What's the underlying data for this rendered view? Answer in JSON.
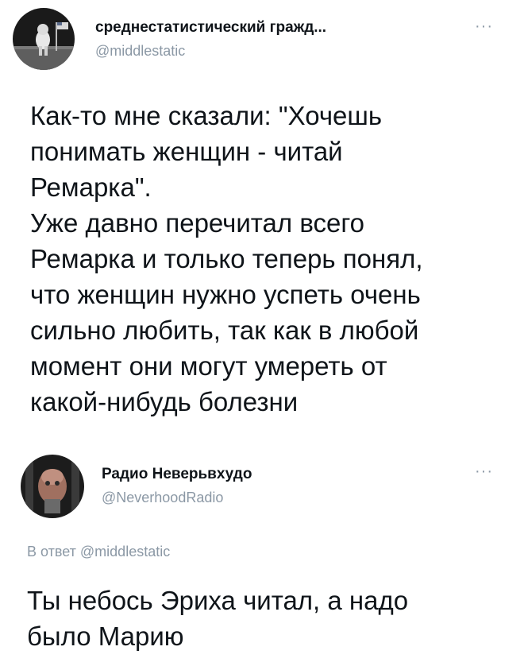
{
  "tweet1": {
    "display_name": "среднестатистический гражд...",
    "handle": "@middlestatic",
    "text": "Как-то мне сказали: \"Хочешь\nпонимать женщин - читай\nРемарка\".\nУже давно перечитал всего\nРемарка и только теперь понял,\nчто женщин нужно успеть очень\nсильно любить, так как в любой\nмомент они могут умереть от\nкакой-нибудь болезни",
    "more_label": "···"
  },
  "tweet2": {
    "display_name": "Радио Неверьвхудо",
    "handle": "@NeverhoodRadio",
    "more_label": "···",
    "reply_prefix": "В ответ",
    "reply_handle": "@middlestatic",
    "text": "Ты небось Эриха читал, а надо\nбыло Марию"
  }
}
